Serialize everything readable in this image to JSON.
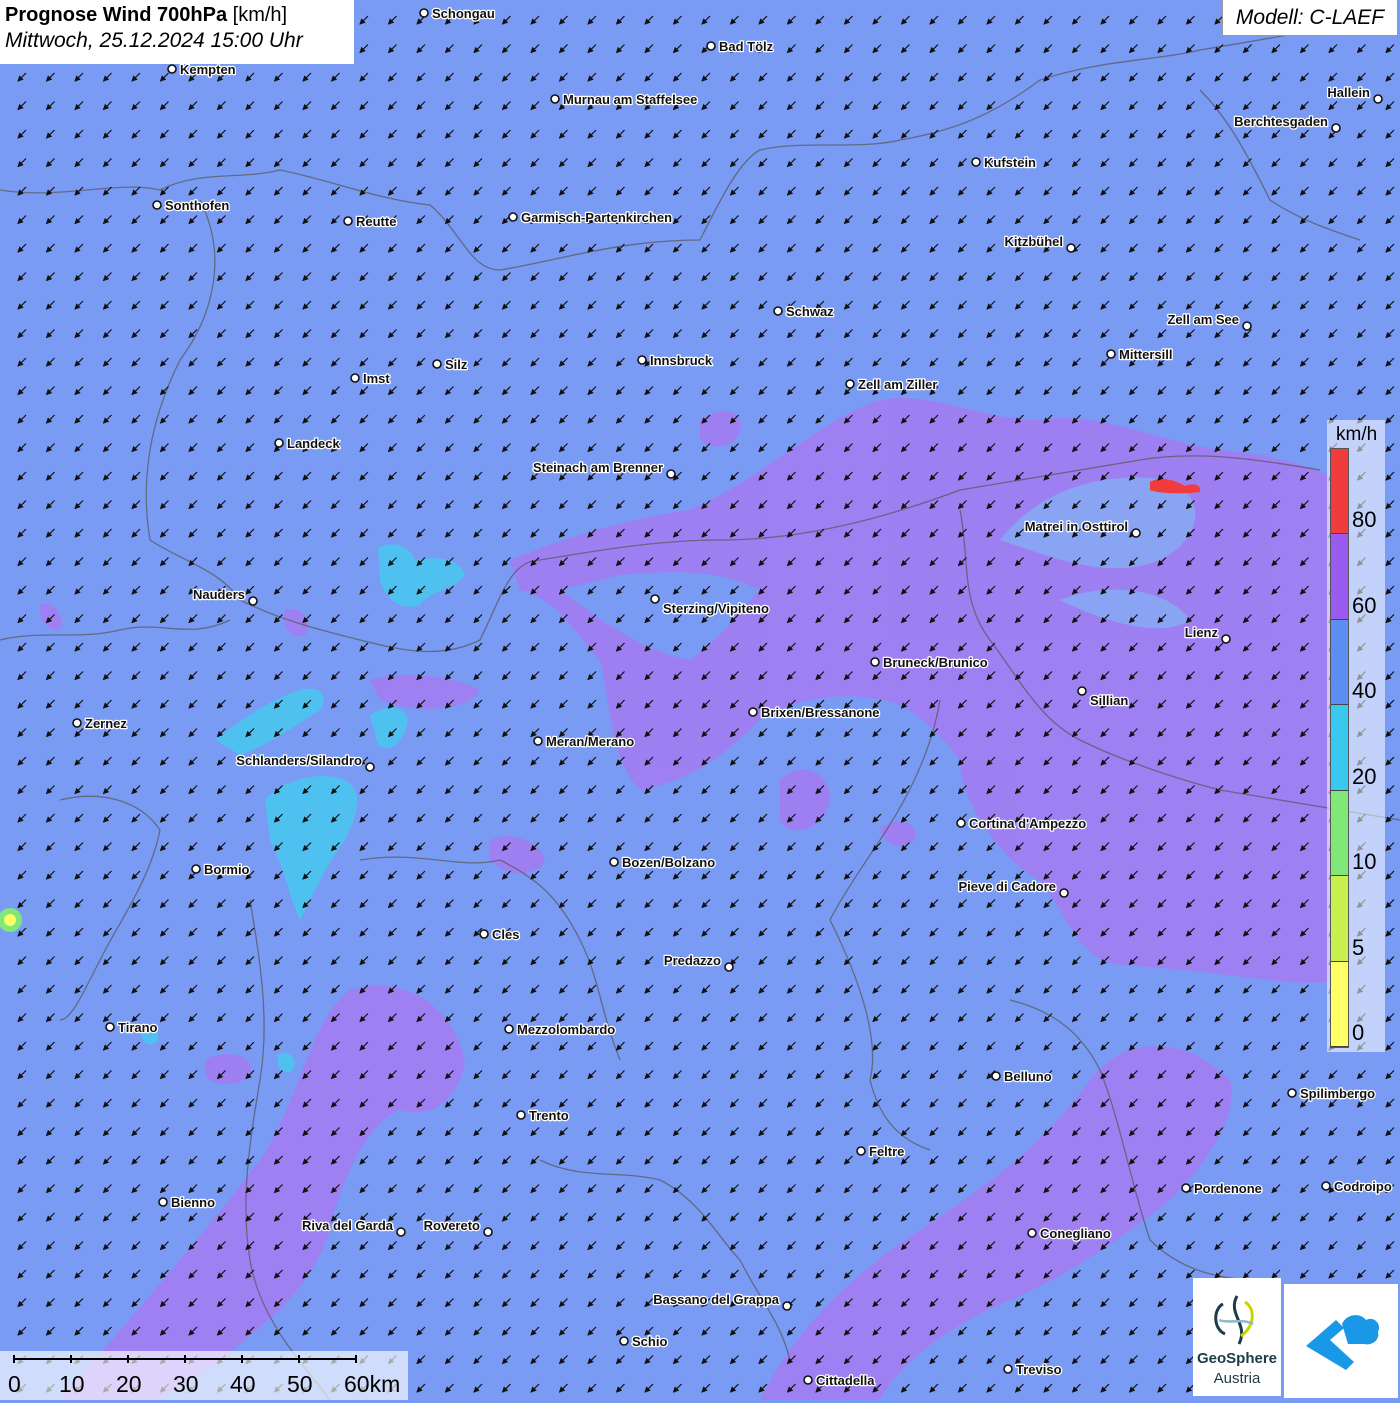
{
  "title": {
    "main": "Prognose Wind 700hPa",
    "unit": "[km/h]",
    "datetime": "Mittwoch, 25.12.2024 15:00 Uhr"
  },
  "model": "Modell: C-LAEF",
  "legend": {
    "unit": "km/h",
    "ticks": [
      "0",
      "5",
      "10",
      "20",
      "40",
      "60",
      "80"
    ],
    "colors": [
      "#ffff66",
      "#c8f050",
      "#80e878",
      "#38c8f0",
      "#5a8ef0",
      "#9a5cf0",
      "#f03c3c"
    ],
    "ranges": [
      "0-5",
      "5-10",
      "10-20",
      "20-40",
      "40-60",
      "60-80",
      ">80"
    ]
  },
  "scalebar": {
    "labels": [
      "0",
      "10",
      "20",
      "30",
      "40",
      "50",
      "60km"
    ]
  },
  "logos": {
    "geosphere_line1": "GeoSphere",
    "geosphere_line2": "Austria"
  },
  "wind_direction": "from north-east (arrows pointing south-west)",
  "cities": [
    {
      "name": "Schongau"
    },
    {
      "name": "Bad Tölz"
    },
    {
      "name": "Kempten"
    },
    {
      "name": "Murnau am Staffelsee"
    },
    {
      "name": "Hallein"
    },
    {
      "name": "Berchtesgaden"
    },
    {
      "name": "Kufstein"
    },
    {
      "name": "Sonthofen"
    },
    {
      "name": "Reutte"
    },
    {
      "name": "Garmisch-Partenkirchen"
    },
    {
      "name": "Kitzbühel"
    },
    {
      "name": "Schwaz"
    },
    {
      "name": "Zell am See"
    },
    {
      "name": "Mittersill"
    },
    {
      "name": "Innsbruck"
    },
    {
      "name": "Silz"
    },
    {
      "name": "Imst"
    },
    {
      "name": "Zell am Ziller"
    },
    {
      "name": "Landeck"
    },
    {
      "name": "Steinach am Brenner"
    },
    {
      "name": "Matrei in Osttirol"
    },
    {
      "name": "Nauders"
    },
    {
      "name": "Sterzing/Vipiteno"
    },
    {
      "name": "Lienz"
    },
    {
      "name": "Bruneck/Brunico"
    },
    {
      "name": "Sillian"
    },
    {
      "name": "Brixen/Bressanone"
    },
    {
      "name": "Zernez"
    },
    {
      "name": "Meran/Merano"
    },
    {
      "name": "Schlanders/Silandro"
    },
    {
      "name": "Cortina d'Ampezzo"
    },
    {
      "name": "Bozen/Bolzano"
    },
    {
      "name": "Bormio"
    },
    {
      "name": "Pieve di Cadore"
    },
    {
      "name": "Cles"
    },
    {
      "name": "Predazzo"
    },
    {
      "name": "Tirano"
    },
    {
      "name": "Mezzolombardo"
    },
    {
      "name": "Belluno"
    },
    {
      "name": "Spilimbergo"
    },
    {
      "name": "Trento"
    },
    {
      "name": "Feltre"
    },
    {
      "name": "Pordenone"
    },
    {
      "name": "Codroipo"
    },
    {
      "name": "Bienno"
    },
    {
      "name": "Riva del Garda"
    },
    {
      "name": "Rovereto"
    },
    {
      "name": "Conegliano"
    },
    {
      "name": "Bassano del Grappa"
    },
    {
      "name": "Schio"
    },
    {
      "name": "Treviso"
    },
    {
      "name": "Cittadella"
    }
  ]
}
